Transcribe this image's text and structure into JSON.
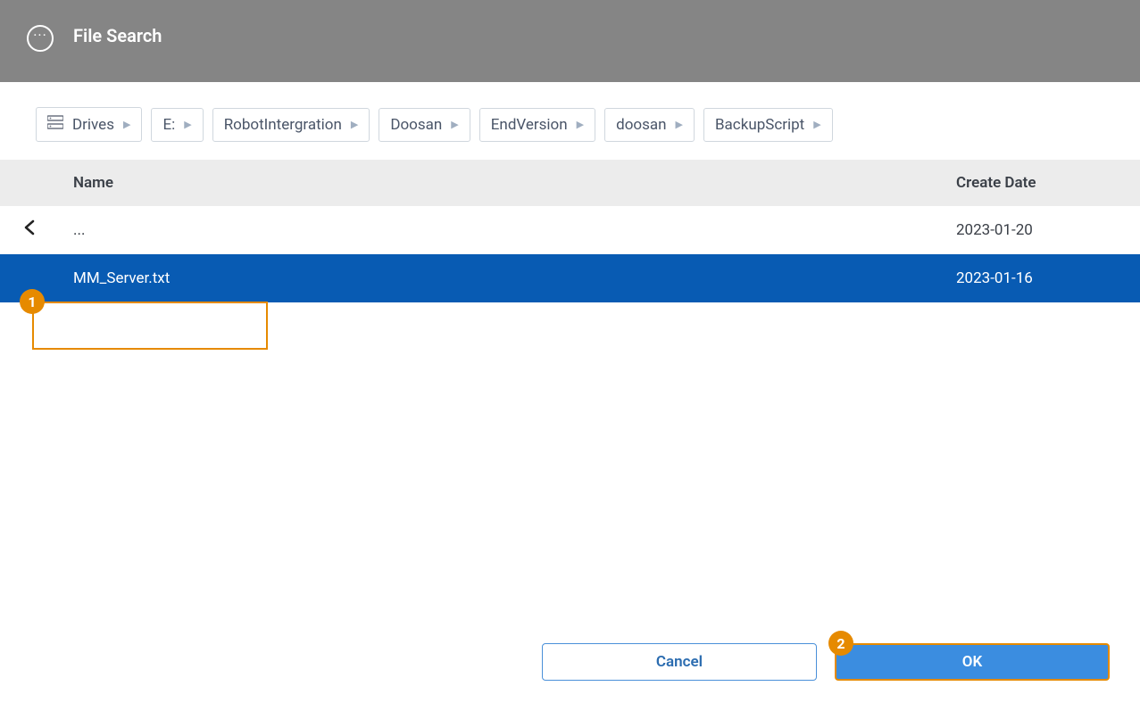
{
  "header": {
    "title": "File Search"
  },
  "breadcrumb": {
    "items": [
      {
        "label": "Drives",
        "hasIcon": true
      },
      {
        "label": "E:",
        "hasIcon": false
      },
      {
        "label": "RobotIntergration",
        "hasIcon": false
      },
      {
        "label": "Doosan",
        "hasIcon": false
      },
      {
        "label": "EndVersion",
        "hasIcon": false
      },
      {
        "label": "doosan",
        "hasIcon": false
      },
      {
        "label": "BackupScript",
        "hasIcon": false
      }
    ]
  },
  "table": {
    "columns": {
      "name": "Name",
      "date": "Create Date"
    },
    "rows": [
      {
        "name": "...",
        "date": "2023-01-20",
        "selected": false,
        "isParent": true
      },
      {
        "name": "MM_Server.txt",
        "date": "2023-01-16",
        "selected": true,
        "isParent": false
      }
    ]
  },
  "footer": {
    "cancel": "Cancel",
    "ok": "OK"
  },
  "callouts": {
    "one": "1",
    "two": "2"
  }
}
